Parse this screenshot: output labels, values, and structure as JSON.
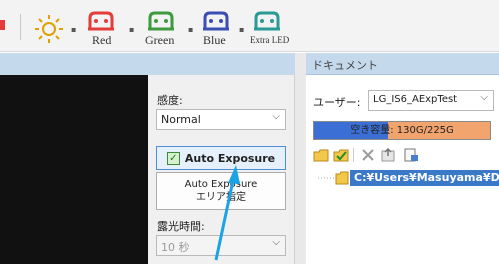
{
  "toolbar": {
    "buttons": [
      {
        "label": "Red",
        "icon": "red-led-icon",
        "color": "#e43b3b"
      },
      {
        "label": "Green",
        "icon": "green-led-icon",
        "color": "#3e9a3e"
      },
      {
        "label": "Blue",
        "icon": "blue-led-icon",
        "color": "#3a4fb5"
      },
      {
        "label": "Extra LED",
        "icon": "extra-led-icon",
        "color": "#2a9a96"
      }
    ]
  },
  "panel": {
    "sensitivity_label": "感度:",
    "sensitivity_value": "Normal",
    "auto_exposure_label": "Auto Exposure",
    "area_button_line1": "Auto Exposure",
    "area_button_line2": "エリア指定",
    "exposure_time_label": "露光時間:",
    "exposure_time_value": "10 秒"
  },
  "documents": {
    "title": "ドキュメント",
    "user_label": "ユーザー:",
    "user_value": "LG_IS6_AExpTest",
    "free_space_text": "空き容量: 130G/225G",
    "used_fraction": 0.42,
    "path": "C:¥Users¥Masuyama¥D"
  },
  "annotation": {
    "color": "#1aa4e6"
  }
}
